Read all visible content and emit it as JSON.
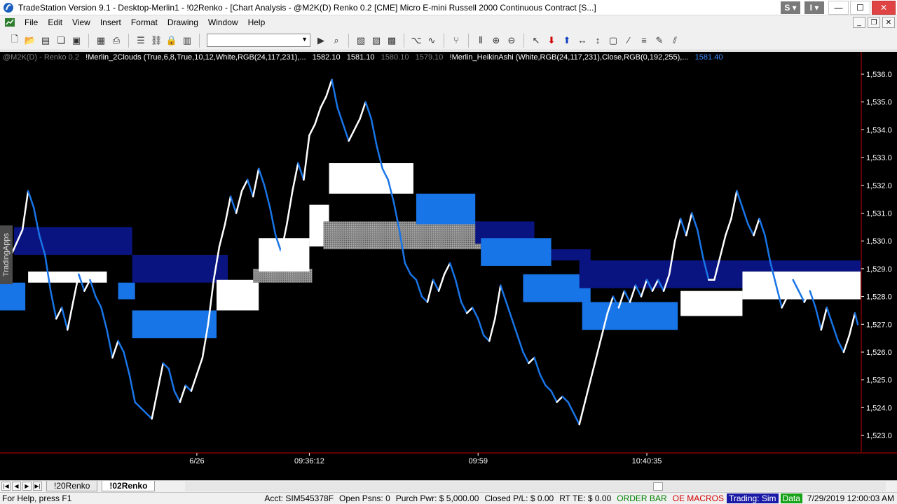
{
  "window": {
    "title": "TradeStation Version 9.1 - Desktop-Merlin1 - !02Renko - [Chart Analysis - @M2K(D) Renko 0.2 [CME] Micro E-mini Russell 2000 Continuous Contract [S...]",
    "ts_s_label": "S",
    "ts_i_label": "I"
  },
  "menu": {
    "items": [
      "File",
      "Edit",
      "View",
      "Insert",
      "Format",
      "Drawing",
      "Window",
      "Help"
    ]
  },
  "legend": {
    "symbol": "@M2K(D) - Renko 0.2",
    "indicator1": "!Merlin_2Clouds (True,6,8,True,10,12,White,RGB(24,117,231),...",
    "v1": "1582.10",
    "v2": "1581.10",
    "v3": "1580.10",
    "v4": "1579.10",
    "indicator2": "!Merlin_HeikinAshi (White,RGB(24,117,231),Close,RGB(0,192,255),...",
    "v5": "1581.40"
  },
  "side_tab": "TradingApps",
  "sheet_tabs": [
    "!20Renko",
    "!02Renko"
  ],
  "status": {
    "help": "For Help, press F1",
    "acct": "Acct: SIM545378F",
    "open_psns": "Open Psns: 0",
    "purch_pwr": "Purch Pwr: $ 5,000.00",
    "closed_pl": "Closed P/L: $ 0.00",
    "rt_te": "RT TE: $ 0.00",
    "order_bar": "ORDER BAR",
    "oe_macros": "OE MACROS",
    "trading": "Trading: Sim",
    "data": "Data",
    "datetime": "7/29/2019 12:00:03 AM"
  },
  "colors": {
    "background": "#000000",
    "price_line": "#1875e7",
    "cloud_navy": "#0a1480",
    "cloud_blue": "#1875e7",
    "cloud_white": "#ffffff",
    "cloud_gray": "#8a8a8a",
    "axis_red": "#c00000"
  },
  "chart_data": {
    "type": "line",
    "ylim": [
      1522.5,
      1536.5
    ],
    "y_ticks": [
      1536,
      1535,
      1534,
      1533,
      1532,
      1531,
      1530,
      1529,
      1528,
      1527,
      1526,
      1525,
      1524,
      1523
    ],
    "y_tick_labels": [
      "1,536.0",
      "1,535.0",
      "1,534.0",
      "1,533.0",
      "1,532.0",
      "1,531.0",
      "1,530.0",
      "1,529.0",
      "1,528.0",
      "1,527.0",
      "1,526.0",
      "1,525.0",
      "1,524.0",
      "1,523.0"
    ],
    "x_ticks": [
      {
        "bar": 70,
        "label": "6/26"
      },
      {
        "bar": 110,
        "label": "09:36:12"
      },
      {
        "bar": 170,
        "label": "09:59"
      },
      {
        "bar": 230,
        "label": "10:40:35"
      }
    ],
    "bar_count": 306,
    "price": [
      [
        0,
        1528.6
      ],
      [
        4,
        1529.5
      ],
      [
        8,
        1530.4
      ],
      [
        10,
        1531.8
      ],
      [
        12,
        1531.2
      ],
      [
        14,
        1530.2
      ],
      [
        16,
        1529.5
      ],
      [
        18,
        1528.2
      ],
      [
        20,
        1527.2
      ],
      [
        22,
        1527.6
      ],
      [
        24,
        1526.8
      ],
      [
        26,
        1527.8
      ],
      [
        28,
        1528.8
      ],
      [
        30,
        1528.2
      ],
      [
        32,
        1528.6
      ],
      [
        34,
        1528.0
      ],
      [
        36,
        1527.6
      ],
      [
        38,
        1526.8
      ],
      [
        40,
        1525.8
      ],
      [
        42,
        1526.4
      ],
      [
        44,
        1526.0
      ],
      [
        46,
        1525.2
      ],
      [
        48,
        1524.2
      ],
      [
        50,
        1524.0
      ],
      [
        52,
        1523.8
      ],
      [
        54,
        1523.6
      ],
      [
        56,
        1524.6
      ],
      [
        58,
        1525.6
      ],
      [
        60,
        1525.4
      ],
      [
        62,
        1524.6
      ],
      [
        64,
        1524.2
      ],
      [
        66,
        1524.8
      ],
      [
        68,
        1524.6
      ],
      [
        70,
        1525.2
      ],
      [
        72,
        1525.8
      ],
      [
        74,
        1527.0
      ],
      [
        76,
        1528.6
      ],
      [
        78,
        1529.8
      ],
      [
        80,
        1530.6
      ],
      [
        82,
        1531.6
      ],
      [
        84,
        1531.0
      ],
      [
        86,
        1531.8
      ],
      [
        88,
        1532.2
      ],
      [
        90,
        1531.6
      ],
      [
        92,
        1532.6
      ],
      [
        94,
        1532.0
      ],
      [
        96,
        1531.2
      ],
      [
        98,
        1530.2
      ],
      [
        100,
        1529.6
      ],
      [
        102,
        1530.6
      ],
      [
        104,
        1531.8
      ],
      [
        106,
        1532.8
      ],
      [
        108,
        1532.2
      ],
      [
        110,
        1533.8
      ],
      [
        112,
        1534.2
      ],
      [
        114,
        1534.8
      ],
      [
        116,
        1535.2
      ],
      [
        118,
        1535.8
      ],
      [
        120,
        1534.8
      ],
      [
        122,
        1534.2
      ],
      [
        124,
        1533.6
      ],
      [
        126,
        1534.0
      ],
      [
        128,
        1534.4
      ],
      [
        130,
        1535.0
      ],
      [
        132,
        1534.4
      ],
      [
        134,
        1533.4
      ],
      [
        136,
        1532.6
      ],
      [
        138,
        1532.2
      ],
      [
        140,
        1531.4
      ],
      [
        142,
        1530.4
      ],
      [
        144,
        1529.2
      ],
      [
        146,
        1528.8
      ],
      [
        148,
        1528.6
      ],
      [
        150,
        1528.0
      ],
      [
        152,
        1527.8
      ],
      [
        154,
        1528.6
      ],
      [
        156,
        1528.2
      ],
      [
        158,
        1528.8
      ],
      [
        160,
        1529.2
      ],
      [
        162,
        1528.6
      ],
      [
        164,
        1527.8
      ],
      [
        166,
        1527.4
      ],
      [
        168,
        1527.6
      ],
      [
        170,
        1527.2
      ],
      [
        172,
        1526.6
      ],
      [
        174,
        1526.4
      ],
      [
        176,
        1527.2
      ],
      [
        178,
        1528.4
      ],
      [
        180,
        1527.8
      ],
      [
        182,
        1527.2
      ],
      [
        184,
        1526.6
      ],
      [
        186,
        1526.0
      ],
      [
        188,
        1525.6
      ],
      [
        190,
        1525.8
      ],
      [
        192,
        1525.2
      ],
      [
        194,
        1524.8
      ],
      [
        196,
        1524.6
      ],
      [
        198,
        1524.2
      ],
      [
        200,
        1524.4
      ],
      [
        202,
        1524.2
      ],
      [
        204,
        1523.8
      ],
      [
        206,
        1523.4
      ],
      [
        208,
        1524.2
      ],
      [
        210,
        1525.0
      ],
      [
        212,
        1525.8
      ],
      [
        214,
        1526.6
      ],
      [
        216,
        1527.4
      ],
      [
        218,
        1528.0
      ],
      [
        220,
        1527.6
      ],
      [
        222,
        1528.2
      ],
      [
        224,
        1527.8
      ],
      [
        226,
        1528.4
      ],
      [
        228,
        1528.0
      ],
      [
        230,
        1528.6
      ],
      [
        232,
        1528.2
      ],
      [
        234,
        1528.6
      ],
      [
        236,
        1528.2
      ],
      [
        238,
        1528.8
      ],
      [
        240,
        1530.0
      ],
      [
        242,
        1530.8
      ],
      [
        244,
        1530.2
      ],
      [
        246,
        1531.0
      ],
      [
        248,
        1530.4
      ],
      [
        250,
        1529.4
      ],
      [
        252,
        1528.6
      ],
      [
        254,
        1528.6
      ],
      [
        256,
        1529.4
      ],
      [
        258,
        1530.2
      ],
      [
        260,
        1530.8
      ],
      [
        262,
        1531.8
      ],
      [
        264,
        1531.2
      ],
      [
        266,
        1530.6
      ],
      [
        268,
        1530.2
      ],
      [
        270,
        1530.8
      ],
      [
        272,
        1530.2
      ],
      [
        274,
        1529.2
      ],
      [
        276,
        1528.4
      ],
      [
        278,
        1527.6
      ],
      [
        280,
        1528.0
      ],
      [
        282,
        1528.6
      ],
      [
        284,
        1528.2
      ],
      [
        286,
        1527.8
      ],
      [
        288,
        1528.2
      ],
      [
        290,
        1527.6
      ],
      [
        292,
        1526.8
      ],
      [
        294,
        1527.6
      ],
      [
        296,
        1527.0
      ],
      [
        298,
        1526.4
      ],
      [
        300,
        1526.0
      ],
      [
        302,
        1526.6
      ],
      [
        304,
        1527.4
      ],
      [
        305,
        1527.0
      ]
    ],
    "clouds": [
      {
        "color": "navy",
        "x0": 5,
        "x1": 47,
        "top": 1530.5,
        "bottom": 1529.5
      },
      {
        "color": "blue",
        "x0": 0,
        "x1": 9,
        "top": 1528.5,
        "bottom": 1527.5
      },
      {
        "color": "white",
        "x0": 10,
        "x1": 38,
        "top": 1528.9,
        "bottom": 1528.5
      },
      {
        "color": "blue",
        "x0": 42,
        "x1": 48,
        "top": 1528.5,
        "bottom": 1527.9
      },
      {
        "color": "navy",
        "x0": 47,
        "x1": 81,
        "top": 1529.5,
        "bottom": 1528.5
      },
      {
        "color": "blue",
        "x0": 47,
        "x1": 77,
        "top": 1527.5,
        "bottom": 1526.5
      },
      {
        "color": "white",
        "x0": 77,
        "x1": 92,
        "top": 1528.6,
        "bottom": 1527.5
      },
      {
        "color": "gray",
        "x0": 90,
        "x1": 111,
        "top": 1529.0,
        "bottom": 1528.5
      },
      {
        "color": "white",
        "x0": 92,
        "x1": 110,
        "top": 1530.1,
        "bottom": 1528.9
      },
      {
        "color": "white",
        "x0": 110,
        "x1": 117,
        "top": 1531.3,
        "bottom": 1529.8
      },
      {
        "color": "gray",
        "x0": 115,
        "x1": 171,
        "top": 1530.7,
        "bottom": 1529.7
      },
      {
        "color": "white",
        "x0": 117,
        "x1": 147,
        "top": 1532.8,
        "bottom": 1531.7
      },
      {
        "color": "blue",
        "x0": 148,
        "x1": 169,
        "top": 1531.7,
        "bottom": 1530.6
      },
      {
        "color": "navy",
        "x0": 169,
        "x1": 190,
        "top": 1530.7,
        "bottom": 1529.9
      },
      {
        "color": "blue",
        "x0": 171,
        "x1": 196,
        "top": 1530.1,
        "bottom": 1529.1
      },
      {
        "color": "blue",
        "x0": 186,
        "x1": 210,
        "top": 1528.8,
        "bottom": 1527.8
      },
      {
        "color": "navy",
        "x0": 196,
        "x1": 210,
        "top": 1529.7,
        "bottom": 1529.3
      },
      {
        "color": "navy",
        "x0": 206,
        "x1": 264,
        "top": 1529.3,
        "bottom": 1528.3
      },
      {
        "color": "blue",
        "x0": 207,
        "x1": 241,
        "top": 1527.8,
        "bottom": 1526.8
      },
      {
        "color": "white",
        "x0": 242,
        "x1": 264,
        "top": 1528.2,
        "bottom": 1527.3
      },
      {
        "color": "navy",
        "x0": 262,
        "x1": 306,
        "top": 1529.3,
        "bottom": 1528.9
      },
      {
        "color": "white",
        "x0": 264,
        "x1": 306,
        "top": 1528.9,
        "bottom": 1527.9
      }
    ]
  }
}
